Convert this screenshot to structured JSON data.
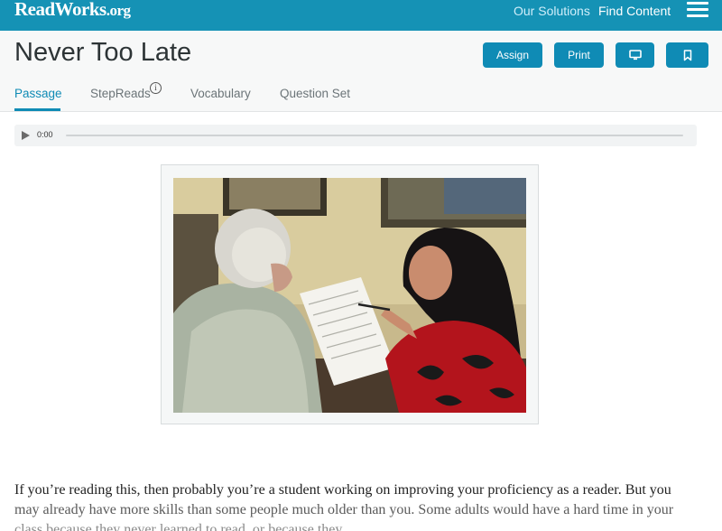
{
  "topbar": {
    "logo_main": "ReadWorks",
    "logo_suffix": ".org",
    "nav": {
      "our_solutions": "Our Solutions",
      "find_content": "Find Content"
    },
    "menu_icon": "hamburger-menu-icon"
  },
  "header": {
    "title": "Never Too Late",
    "buttons": {
      "assign": "Assign",
      "print": "Print",
      "present_icon": "monitor-icon",
      "bookmark_icon": "bookmark-icon"
    },
    "tabs": [
      {
        "label": "Passage",
        "active": true
      },
      {
        "label": "StepReads",
        "info_icon": "info-icon",
        "info_glyph": "i"
      },
      {
        "label": "Vocabulary"
      },
      {
        "label": "Question Set"
      }
    ]
  },
  "audio": {
    "time": "0:00",
    "play_icon": "play-icon",
    "progress": 0
  },
  "passage": {
    "line1": "If you’re reading this, then probably you’re a student working on improving your proficiency as a reader. But you",
    "line2": "may already have more skills than some people much older than you. Some adults would have a hard time in your",
    "line3": "class because they never learned to read, or because they"
  },
  "colors": {
    "brand": "#1592b5",
    "button": "#0f8bb5",
    "active_tab": "#0f8bb5"
  }
}
